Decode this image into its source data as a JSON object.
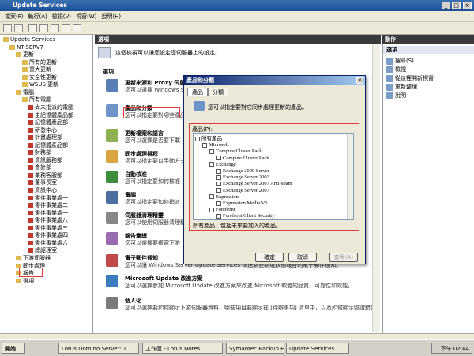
{
  "window": {
    "title": "Update Services"
  },
  "menu": [
    "檔案(F)",
    "執行(A)",
    "檢視(V)",
    "視窗(W)",
    "說明(H)"
  ],
  "tree": [
    {
      "label": "Update Services",
      "indent": 0
    },
    {
      "label": "NT-SERV7",
      "indent": 1
    },
    {
      "label": "更新",
      "indent": 2
    },
    {
      "label": "所有的更新",
      "indent": 3
    },
    {
      "label": "重大更新",
      "indent": 3
    },
    {
      "label": "安全性更新",
      "indent": 3
    },
    {
      "label": "WSUS 更新",
      "indent": 3
    },
    {
      "label": "電腦",
      "indent": 2
    },
    {
      "label": "所有電腦",
      "indent": 3
    },
    {
      "label": "尚未指派的電腦",
      "indent": 4
    },
    {
      "label": "主記憶體產品部",
      "indent": 4
    },
    {
      "label": "記憶體產品部",
      "indent": 4
    },
    {
      "label": "研發中心",
      "indent": 4
    },
    {
      "label": "計畫處理部",
      "indent": 4
    },
    {
      "label": "記憶體產品部",
      "indent": 4
    },
    {
      "label": "財務部",
      "indent": 4
    },
    {
      "label": "資訊服務部",
      "indent": 4
    },
    {
      "label": "會計部",
      "indent": 4
    },
    {
      "label": "業務客服部",
      "indent": 4
    },
    {
      "label": "董事長室",
      "indent": 4
    },
    {
      "label": "資訊中心",
      "indent": 4
    },
    {
      "label": "零件事業處一",
      "indent": 4
    },
    {
      "label": "零件事業處二",
      "indent": 4
    },
    {
      "label": "零件事業處一",
      "indent": 4
    },
    {
      "label": "零件事業處八",
      "indent": 4
    },
    {
      "label": "零件事業處三",
      "indent": 4
    },
    {
      "label": "零件事業處四",
      "indent": 4
    },
    {
      "label": "零件事業處六",
      "indent": 4
    },
    {
      "label": "總經理室",
      "indent": 4
    },
    {
      "label": "下游伺服器",
      "indent": 2
    },
    {
      "label": "同步處理",
      "indent": 2
    },
    {
      "label": "報告",
      "indent": 2
    },
    {
      "label": "選項",
      "indent": 2
    }
  ],
  "main": {
    "header": "選項",
    "description": "這個檢視可以讓您設定您伺服器上的設定。",
    "section": "選項",
    "options": [
      {
        "title": "更新來源和 Proxy 伺服器",
        "desc": "您可以選擇 Windows Server Update Services 從 Microsoft",
        "color": "#5a7fb8"
      },
      {
        "title": "產品和分類",
        "desc": "您可以指定要對哪些產品",
        "color": "#6f95c8"
      },
      {
        "title": "更新檔案和語言",
        "desc": "您可以選擇是否要下載",
        "color": "#8fb14f"
      },
      {
        "title": "同步處理排程",
        "desc": "您可以指定要以手動方式",
        "color": "#d9a441"
      },
      {
        "title": "自動核准",
        "desc": "您可以指定要如何核准",
        "color": "#3c8d3c"
      },
      {
        "title": "電腦",
        "desc": "您可以指定要如何指派",
        "color": "#4a6fa0"
      },
      {
        "title": "伺服器清理精靈",
        "desc": "您可以使用伺服器清理精靈",
        "color": "#888888"
      },
      {
        "title": "報告彙總",
        "desc": "您可以選擇要複寫下游",
        "color": "#9a6bb0"
      },
      {
        "title": "電子郵件通知",
        "desc": "您可以讓 Windows Server Update Services 傳送新更新或狀態報告的電子郵件通知。",
        "color": "#c04848"
      },
      {
        "title": "Microsoft Update 改進方案",
        "desc": "您可以選擇參加 Microsoft Update 改進方案來改進 Microsoft 軟體的品質、可靠性和效能。",
        "color": "#3b7bbf"
      },
      {
        "title": "個人化",
        "desc": "您可以選擇要如何顯示下游伺服器資料、哪些項目要顯示在 [待辦事項] 清單中，以及如何顯示驗證錯誤。",
        "color": "#7a7a7a"
      }
    ]
  },
  "actions": {
    "header": "動作",
    "section": "選項",
    "items": [
      "搜尋(S)...",
      "檢視",
      "從這裡開新視窗",
      "重新整理",
      "說明"
    ]
  },
  "dialog": {
    "title": "產品和分類",
    "tabs": [
      "產品",
      "分類"
    ],
    "description": "您可以指定要對它同步處理更新的產品。",
    "list_label": "產品(P):",
    "products": [
      {
        "label": "所有產品",
        "indent": 0
      },
      {
        "label": "Microsoft",
        "indent": 1
      },
      {
        "label": "Compute Cluster Pack",
        "indent": 2
      },
      {
        "label": "Compute Cluster Pack",
        "indent": 3
      },
      {
        "label": "Exchange",
        "indent": 2
      },
      {
        "label": "Exchange 2000 Server",
        "indent": 3
      },
      {
        "label": "Exchange Server 2003",
        "indent": 3
      },
      {
        "label": "Exchange Server 2007 Anti-spam",
        "indent": 3
      },
      {
        "label": "Exchange Server 2007",
        "indent": 3
      },
      {
        "label": "Expression",
        "indent": 2
      },
      {
        "label": "Expression Media V1",
        "indent": 3
      },
      {
        "label": "Forefront",
        "indent": 2
      },
      {
        "label": "Forefront Client Security",
        "indent": 3
      }
    ],
    "note": "所有產品，包括未來要加入的產品。",
    "buttons": {
      "ok": "確定",
      "cancel": "取消",
      "apply": "套用(A)"
    }
  },
  "taskbar": {
    "start": "開始",
    "tasks": [
      "Lotus Domino Server: T...",
      "工作匣 - Lotus Notes",
      "Symantec Backup Exec -...",
      "Update Services"
    ],
    "clock": "下午 02:44"
  }
}
